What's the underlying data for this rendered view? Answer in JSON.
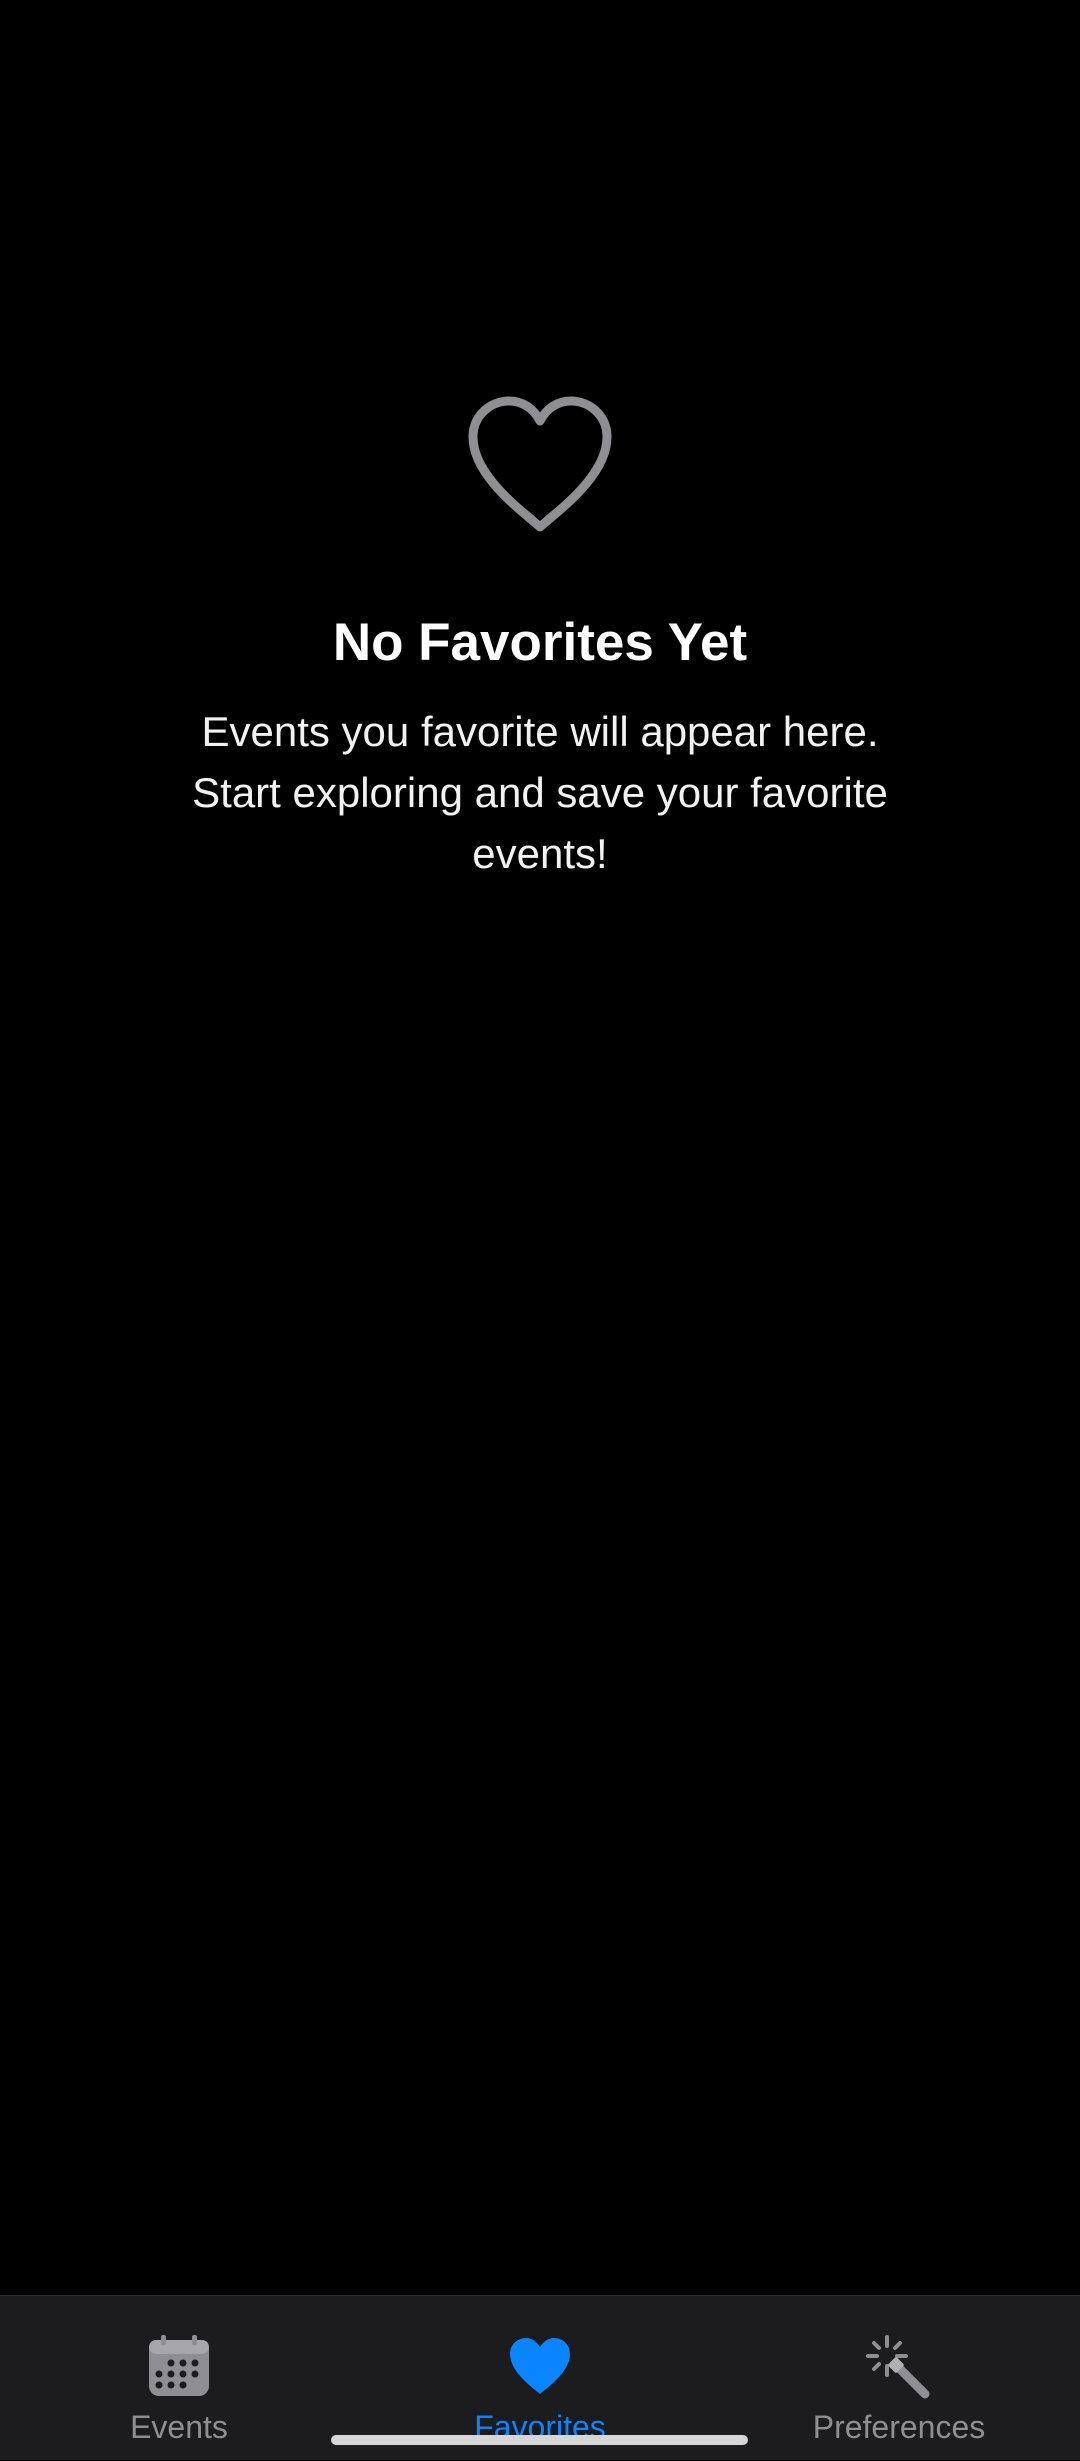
{
  "empty_state": {
    "icon": "heart-outline-icon",
    "title": "No Favorites Yet",
    "message": "Events you favorite will appear here. Start exploring and save your favorite events!"
  },
  "tab_bar": {
    "active_color": "#0a84ff",
    "inactive_color": "#8e8e93",
    "tabs": [
      {
        "label": "Events",
        "icon": "calendar-icon",
        "active": false
      },
      {
        "label": "Favorites",
        "icon": "heart-filled-icon",
        "active": true
      },
      {
        "label": "Preferences",
        "icon": "magic-wand-icon",
        "active": false
      }
    ]
  }
}
